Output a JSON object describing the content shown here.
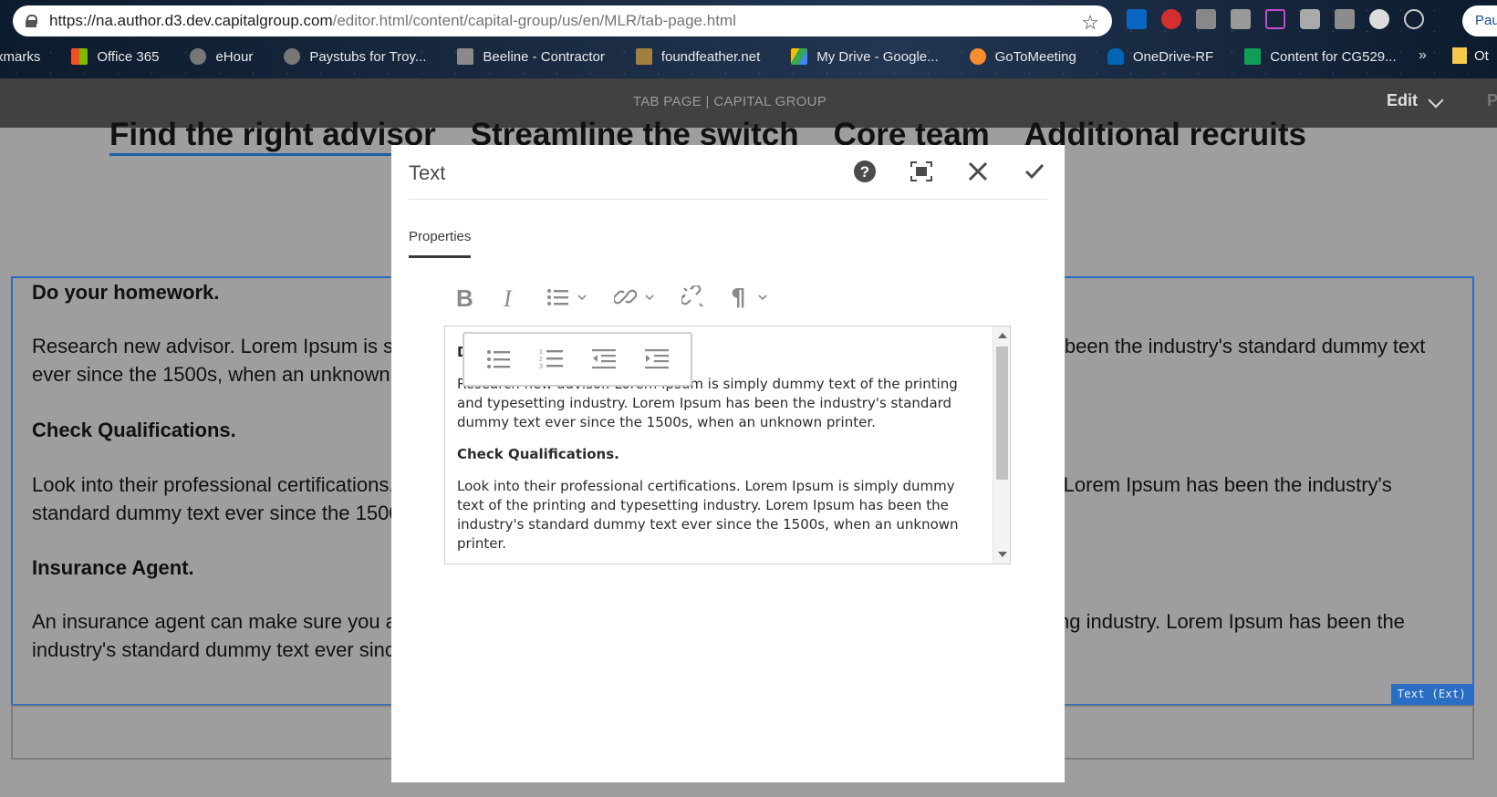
{
  "browser": {
    "url_main": "https://na.author.d3.dev.capitalgroup.com",
    "url_path": "/editor.html/content/capital-group/us/en/MLR/tab-page.html",
    "profile_label": "Pau",
    "bookmarks": [
      {
        "label": "xmarks",
        "icon": "none"
      },
      {
        "label": "Office 365",
        "icon": "microsoft-logo-icon"
      },
      {
        "label": "eHour",
        "icon": "globe-icon"
      },
      {
        "label": "Paystubs for Troy...",
        "icon": "globe-icon"
      },
      {
        "label": "Beeline - Contractor",
        "icon": "beeline-icon"
      },
      {
        "label": "foundfeather.net",
        "icon": "feather-icon"
      },
      {
        "label": "My Drive - Google...",
        "icon": "google-drive-icon"
      },
      {
        "label": "GoToMeeting",
        "icon": "gotomeeting-icon"
      },
      {
        "label": "OneDrive-RF",
        "icon": "onedrive-icon"
      },
      {
        "label": "Content for CG529...",
        "icon": "google-sheets-icon"
      }
    ],
    "more_label": "»",
    "other_label": "Ot"
  },
  "editor_bar": {
    "page_title": "TAB PAGE | CAPITAL GROUP",
    "mode_label": "Edit",
    "right_label": "P"
  },
  "page": {
    "tabs": [
      "Find the right advisor",
      "Streamline the switch",
      "Core team",
      "Additional recruits"
    ],
    "paragraphs": [
      {
        "type": "heading",
        "text": "Do your homework."
      },
      {
        "type": "body",
        "text": "Research new advisor. Lorem Ipsum is simply dummy text of the printing and typesetting industry. Lorem Ipsum has been the industry's standard dummy text ever since the 1500s, when an unknown printer."
      },
      {
        "type": "heading",
        "text": "Check Qualifications."
      },
      {
        "type": "body",
        "text": "Look into their professional certifications. Lorem Ipsum is simply dummy text of the printing and typesetting industry. Lorem Ipsum has been the industry's standard dummy text ever since the 1500s, when an unknown printer."
      },
      {
        "type": "heading",
        "text": "Insurance Agent."
      },
      {
        "type": "body",
        "text": "An insurance agent can make sure you are covered. Lorem Ipsum is simply dummy text of the printing and typesetting industry. Lorem Ipsum has been the industry's standard dummy text ever since the 1500s, when an unknown printer."
      }
    ],
    "component_badge": "Text (Ext)"
  },
  "dialog": {
    "title": "Text",
    "tab_label": "Properties",
    "actions": [
      "help-icon",
      "fullscreen-icon",
      "close-icon",
      "confirm-icon"
    ],
    "toolbar": [
      "bold-icon",
      "italic-icon",
      "list-icon",
      "link-icon",
      "unlink-icon",
      "paragraph-icon"
    ],
    "list_popover": [
      "bulleted-list-icon",
      "numbered-list-icon",
      "outdent-icon",
      "indent-icon"
    ],
    "content": {
      "first_heading_visible": "D",
      "p1": "Research new advisor. Lorem Ipsum is simply dummy text of the printing and typesetting industry. Lorem Ipsum has been the industry's standard dummy text ever since the 1500s, when an unknown printer.",
      "h2": "Check Qualifications.",
      "p2": "Look into their professional certifications. Lorem Ipsum is simply dummy text of the printing and typesetting industry. Lorem Ipsum has been the industry's standard dummy text ever since the 1500s, when an unknown printer."
    }
  },
  "colors": {
    "accent_blue": "#2a6ec4",
    "editor_bar": "#414141",
    "overlay": "#9e9e9e"
  }
}
